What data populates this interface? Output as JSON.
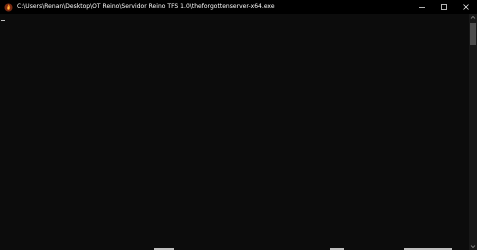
{
  "window": {
    "title": "C:\\Users\\Renan\\Desktop\\OT Reino\\Servidor Reino TFS 1.0\\theforgottenserver-x64.exe",
    "app_icon": "tfs-flame-icon",
    "controls": {
      "minimize": "—",
      "maximize": "☐",
      "close": "✕"
    }
  },
  "console": {
    "text": "",
    "cursor": "_"
  },
  "scrollbar": {
    "up_icon": "scroll-up-arrow-icon",
    "down_icon": "scroll-down-arrow-icon"
  },
  "colors": {
    "console_bg": "#0c0c0c",
    "titlebar_bg": "#000000",
    "text": "#ffffff",
    "scroll_thumb": "#4d4d4d"
  }
}
